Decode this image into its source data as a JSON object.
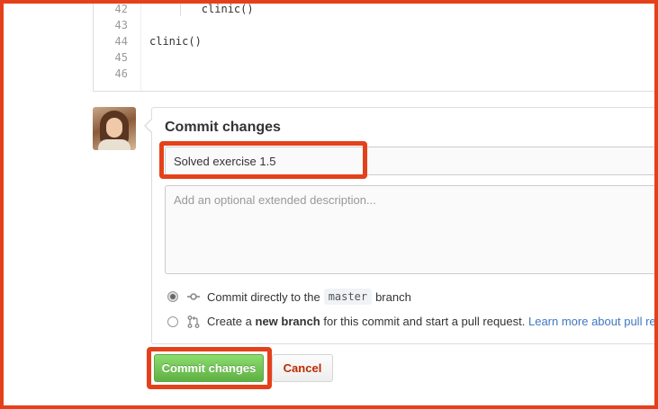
{
  "editor": {
    "lines": [
      {
        "number": "42",
        "code": "        clinic()"
      },
      {
        "number": "43",
        "code": ""
      },
      {
        "number": "44",
        "code": "clinic()"
      },
      {
        "number": "45",
        "code": ""
      },
      {
        "number": "46",
        "code": ""
      }
    ]
  },
  "commit": {
    "title": "Commit changes",
    "summary_value": "Solved exercise 1.5",
    "description_placeholder": "Add an optional extended description...",
    "option_direct": {
      "prefix": "Commit directly to the",
      "branch": "master",
      "suffix": "branch"
    },
    "option_new_branch": {
      "prefix": "Create a",
      "bold": "new branch",
      "middle": "for this commit and start a pull request.",
      "link": "Learn more about pull re"
    },
    "commit_button": "Commit changes",
    "cancel_button": "Cancel"
  },
  "colors": {
    "highlight": "#e4411b",
    "commit_green": "#60b044",
    "cancel_red": "#bd2c00",
    "link_blue": "#4078c0"
  },
  "icons": [
    "git-commit-icon",
    "git-pull-request-icon"
  ]
}
